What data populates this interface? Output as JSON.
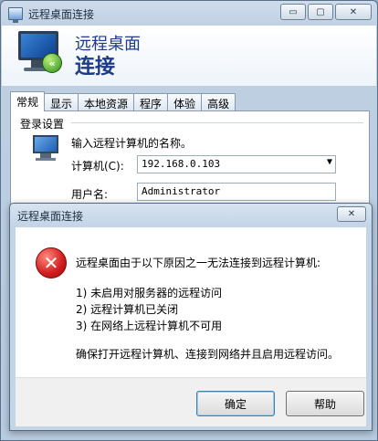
{
  "main_window": {
    "title": "远程桌面连接",
    "controls": {
      "minimize": "▭",
      "maximize": "▢",
      "close": "✕"
    },
    "header": {
      "line1": "远程桌面",
      "line2": "连接"
    },
    "tabs": [
      {
        "label": "常规",
        "active": true
      },
      {
        "label": "显示"
      },
      {
        "label": "本地资源"
      },
      {
        "label": "程序"
      },
      {
        "label": "体验"
      },
      {
        "label": "高级"
      }
    ],
    "login_group": {
      "title": "登录设置",
      "prompt": "输入远程计算机的名称。",
      "computer_label": "计算机(C):",
      "computer_value": "192.168.0.103",
      "combo_arrow": "▼",
      "username_label": "用户名:",
      "username_value": "Administrator"
    }
  },
  "dialog": {
    "title": "远程桌面连接",
    "close": "✕",
    "icon_glyph": "✕",
    "message": "远程桌面由于以下原因之一无法连接到远程计算机:",
    "reasons": [
      "1) 未启用对服务器的远程访问",
      "2) 远程计算机已关闭",
      "3) 在网络上远程计算机不可用"
    ],
    "footer_text": "确保打开远程计算机、连接到网络并且启用远程访问。",
    "buttons": {
      "ok": "确定",
      "help": "帮助"
    }
  },
  "colors": {
    "title_blue": "#1e3a8a",
    "error_red": "#d01b1b",
    "accent": "#3c7fb1"
  }
}
